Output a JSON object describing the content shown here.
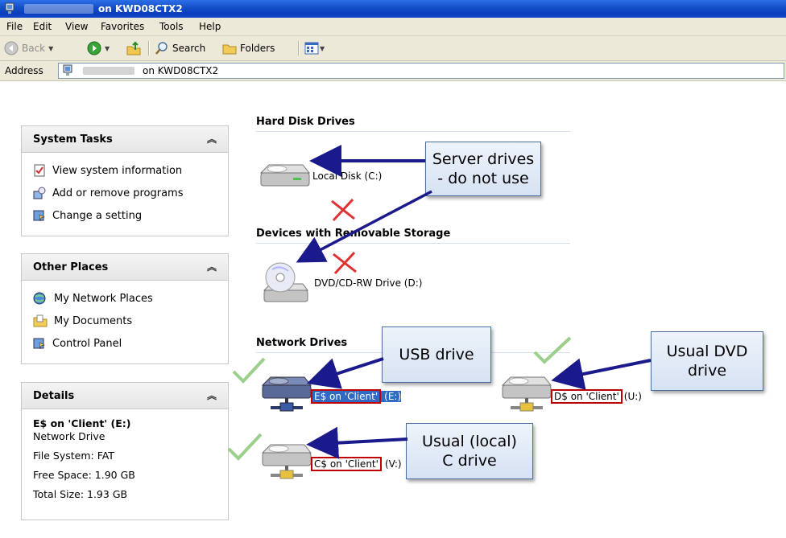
{
  "window": {
    "title_suffix": "on KWD08CTX2"
  },
  "menubar": {
    "items": [
      "File",
      "Edit",
      "View",
      "Favorites",
      "Tools",
      "Help"
    ]
  },
  "toolbar": {
    "back_label": "Back",
    "search_label": "Search",
    "folders_label": "Folders"
  },
  "address": {
    "label": "Address",
    "value_suffix": "on KWD08CTX2"
  },
  "left": {
    "system_tasks": {
      "title": "System Tasks",
      "items": [
        "View system information",
        "Add or remove programs",
        "Change a setting"
      ]
    },
    "other_places": {
      "title": "Other Places",
      "items": [
        "My Network Places",
        "My Documents",
        "Control Panel"
      ]
    },
    "details": {
      "title": "Details",
      "name": "E$ on 'Client' (E:)",
      "type": "Network Drive",
      "file_system": "File System: FAT",
      "free_space": "Free Space: 1.90 GB",
      "total_size": "Total Size: 1.93 GB"
    },
    "collapse_glyph": "»"
  },
  "main": {
    "sections": {
      "hard_disk": "Hard Disk Drives",
      "removable": "Devices with Removable Storage",
      "network": "Network Drives"
    },
    "drives": {
      "local_c": "Local Disk (C:)",
      "dvd": "DVD/CD-RW Drive (D:)",
      "e_name": "E$ on 'Client'",
      "e_letter": "(E:)",
      "d_name": "D$ on 'Client'",
      "d_letter": "(U:)",
      "c_name": "C$ on 'Client'",
      "c_letter": "(V:)"
    }
  },
  "callouts": {
    "server": "Server drives\n- do not use",
    "usb": "USB drive",
    "usual_dvd": "Usual DVD\ndrive",
    "usual_c": "Usual (local)\nC drive"
  },
  "colors": {
    "arrow": "#1a1a8c",
    "highlight_box": "#c00000",
    "check": "#9ccf8c",
    "cross": "#e03030"
  }
}
